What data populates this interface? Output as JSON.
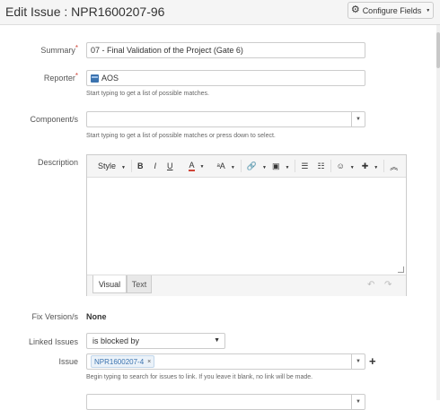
{
  "header": {
    "title": "Edit Issue : NPR1600207-96",
    "configure_label": "Configure Fields"
  },
  "form": {
    "summary": {
      "label": "Summary",
      "required_mark": "*",
      "value": "07 - Final Validation of the Project (Gate 6)"
    },
    "reporter": {
      "label": "Reporter",
      "required_mark": "*",
      "value": "AOS",
      "help": "Start typing to get a list of possible matches."
    },
    "components": {
      "label": "Component/s",
      "value": "",
      "help": "Start typing to get a list of possible matches or press down to select."
    },
    "description": {
      "label": "Description",
      "toolbar": {
        "style": "Style",
        "bold": "B",
        "italic": "I",
        "underline": "U",
        "color": "A",
        "size": "ᵃA"
      },
      "tabs": {
        "visual": "Visual",
        "text": "Text"
      },
      "undo": "↶",
      "redo": "↷"
    },
    "fix_versions": {
      "label": "Fix Version/s",
      "value": "None"
    },
    "linked_issues": {
      "label": "Linked Issues",
      "value": "is blocked by"
    },
    "issue": {
      "label": "Issue",
      "tag": "NPR1600207-4",
      "tag_remove": "×",
      "help": "Begin typing to search for issues to link. If you leave it blank, no link will be made.",
      "add": "+"
    }
  }
}
